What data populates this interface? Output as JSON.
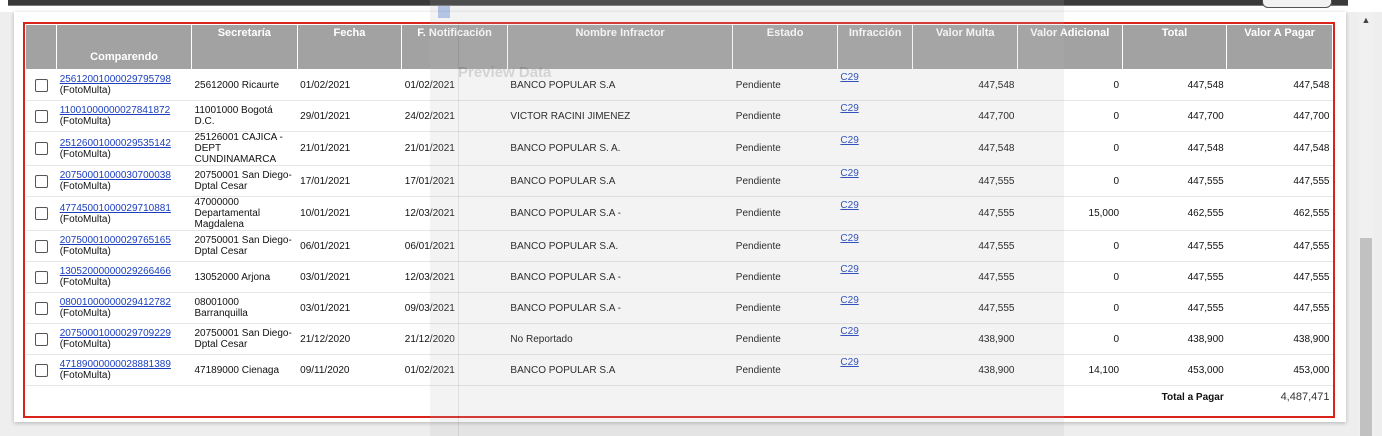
{
  "columns": {
    "comparendo": "Comparendo",
    "secretaria": "Secretaría",
    "fecha": "Fecha",
    "notificacion": "F. Notificación",
    "infractor": "Nombre Infractor",
    "estado": "Estado",
    "infraccion": "Infracción",
    "valor_multa": "Valor Multa",
    "valor_adicional": "Valor Adicional",
    "total": "Total",
    "valor_pagar": "Valor A Pagar"
  },
  "rows": [
    {
      "comparendo": "25612001000029795798",
      "tipo": "(FotoMulta)",
      "secretaria": "25612000 Ricaurte",
      "fecha": "01/02/2021",
      "notificacion": "01/02/2021",
      "infractor": "BANCO POPULAR S.A",
      "estado": "Pendiente",
      "infraccion": "C29",
      "valor_multa": "447,548",
      "valor_adicional": "0",
      "total": "447,548",
      "valor_pagar": "447,548"
    },
    {
      "comparendo": "11001000000027841872",
      "tipo": "(FotoMulta)",
      "secretaria": "11001000 Bogotá D.C.",
      "fecha": "29/01/2021",
      "notificacion": "24/02/2021",
      "infractor": "VICTOR RACINI JIMENEZ",
      "estado": "Pendiente",
      "infraccion": "C29",
      "valor_multa": "447,700",
      "valor_adicional": "0",
      "total": "447,700",
      "valor_pagar": "447,700"
    },
    {
      "comparendo": "25126001000029535142",
      "tipo": "(FotoMulta)",
      "secretaria": "25126001 CAJICA - DEPT CUNDINAMARCA",
      "fecha": "21/01/2021",
      "notificacion": "21/01/2021",
      "infractor": "BANCO POPULAR S. A.",
      "estado": "Pendiente",
      "infraccion": "C29",
      "valor_multa": "447,548",
      "valor_adicional": "0",
      "total": "447,548",
      "valor_pagar": "447,548"
    },
    {
      "comparendo": "20750001000030700038",
      "tipo": "(FotoMulta)",
      "secretaria": "20750001 San Diego-Dptal Cesar",
      "fecha": "17/01/2021",
      "notificacion": "17/01/2021",
      "infractor": "BANCO POPULAR S.A",
      "estado": "Pendiente",
      "infraccion": "C29",
      "valor_multa": "447,555",
      "valor_adicional": "0",
      "total": "447,555",
      "valor_pagar": "447,555"
    },
    {
      "comparendo": "47745001000029710881",
      "tipo": "(FotoMulta)",
      "secretaria": "47000000 Departamental Magdalena",
      "fecha": "10/01/2021",
      "notificacion": "12/03/2021",
      "infractor": "BANCO POPULAR S.A -",
      "estado": "Pendiente",
      "infraccion": "C29",
      "valor_multa": "447,555",
      "valor_adicional": "15,000",
      "total": "462,555",
      "valor_pagar": "462,555"
    },
    {
      "comparendo": "20750001000029765165",
      "tipo": "(FotoMulta)",
      "secretaria": "20750001 San Diego-Dptal Cesar",
      "fecha": "06/01/2021",
      "notificacion": "06/01/2021",
      "infractor": "BANCO POPULAR S.A.",
      "estado": "Pendiente",
      "infraccion": "C29",
      "valor_multa": "447,555",
      "valor_adicional": "0",
      "total": "447,555",
      "valor_pagar": "447,555"
    },
    {
      "comparendo": "13052000000029266466",
      "tipo": "(FotoMulta)",
      "secretaria": "13052000 Arjona",
      "fecha": "03/01/2021",
      "notificacion": "12/03/2021",
      "infractor": "BANCO POPULAR S.A -",
      "estado": "Pendiente",
      "infraccion": "C29",
      "valor_multa": "447,555",
      "valor_adicional": "0",
      "total": "447,555",
      "valor_pagar": "447,555"
    },
    {
      "comparendo": "08001000000029412782",
      "tipo": "(FotoMulta)",
      "secretaria": "08001000 Barranquilla",
      "fecha": "03/01/2021",
      "notificacion": "09/03/2021",
      "infractor": "BANCO POPULAR S.A -",
      "estado": "Pendiente",
      "infraccion": "C29",
      "valor_multa": "447,555",
      "valor_adicional": "0",
      "total": "447,555",
      "valor_pagar": "447,555"
    },
    {
      "comparendo": "20750001000029709229",
      "tipo": "(FotoMulta)",
      "secretaria": "20750001 San Diego-Dptal Cesar",
      "fecha": "21/12/2020",
      "notificacion": "21/12/2020",
      "infractor": "No Reportado",
      "estado": "Pendiente",
      "infraccion": "C29",
      "valor_multa": "438,900",
      "valor_adicional": "0",
      "total": "438,900",
      "valor_pagar": "438,900"
    },
    {
      "comparendo": "47189000000028881389",
      "tipo": "(FotoMulta)",
      "secretaria": "47189000 Cienaga",
      "fecha": "09/11/2020",
      "notificacion": "01/02/2021",
      "infractor": "BANCO POPULAR S.A",
      "estado": "Pendiente",
      "infraccion": "C29",
      "valor_multa": "438,900",
      "valor_adicional": "14,100",
      "total": "453,000",
      "valor_pagar": "453,000"
    }
  ],
  "footer": {
    "total_label": "Total a Pagar",
    "total_value": "4,487,471"
  },
  "overlay": {
    "title": "Preview Data"
  },
  "scrollbar": {
    "up_arrow": "▲"
  }
}
